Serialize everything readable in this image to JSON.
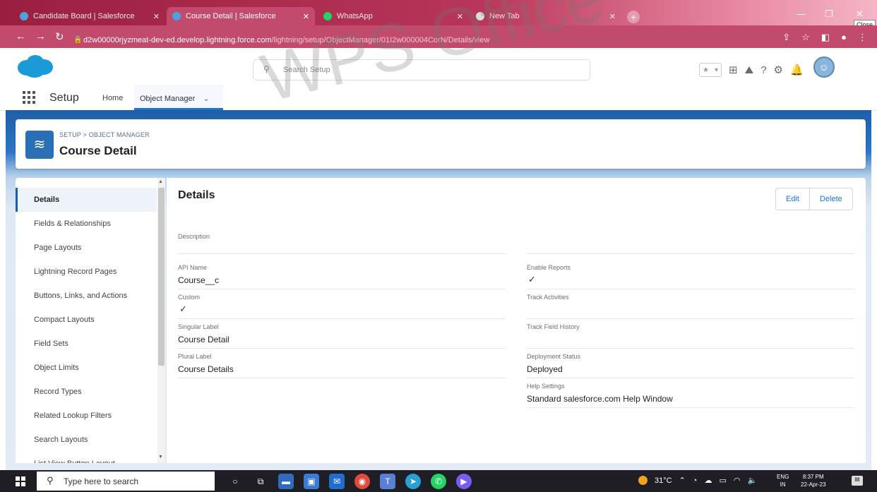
{
  "browser": {
    "tabs": [
      {
        "title": "Candidate Board | Salesforce",
        "active": false,
        "favicon_color": "#4aa3df"
      },
      {
        "title": "Course Detail | Salesforce",
        "active": true,
        "favicon_color": "#4aa3df"
      },
      {
        "title": "WhatsApp",
        "active": false,
        "favicon_color": "#25d366"
      },
      {
        "title": "New Tab",
        "active": false,
        "favicon_color": "#dddddd"
      }
    ],
    "close_tooltip": "Close",
    "url_host": "d2w00000rjyzmeat-dev-ed.develop.lightning.force.com",
    "url_path": "/lightning/setup/ObjectManager/01I2w000004CorN/Details/view"
  },
  "header": {
    "search_placeholder": "Search Setup"
  },
  "nav": {
    "app_name": "Setup",
    "home": "Home",
    "object_manager": "Object Manager"
  },
  "object": {
    "breadcrumb": "SETUP > OBJECT MANAGER",
    "title": "Course Detail"
  },
  "sidebar": {
    "items": [
      {
        "label": "Details",
        "active": true
      },
      {
        "label": "Fields & Relationships",
        "active": false
      },
      {
        "label": "Page Layouts",
        "active": false
      },
      {
        "label": "Lightning Record Pages",
        "active": false
      },
      {
        "label": "Buttons, Links, and Actions",
        "active": false
      },
      {
        "label": "Compact Layouts",
        "active": false
      },
      {
        "label": "Field Sets",
        "active": false
      },
      {
        "label": "Object Limits",
        "active": false
      },
      {
        "label": "Record Types",
        "active": false
      },
      {
        "label": "Related Lookup Filters",
        "active": false
      },
      {
        "label": "Search Layouts",
        "active": false
      },
      {
        "label": "List View Button Layout",
        "active": false
      }
    ]
  },
  "details": {
    "title": "Details",
    "edit_label": "Edit",
    "delete_label": "Delete",
    "left": [
      {
        "label": "Description",
        "value": ""
      },
      {
        "label": "API Name",
        "value": "Course__c"
      },
      {
        "label": "Custom",
        "value": "✓"
      },
      {
        "label": "Singular Label",
        "value": "Course Detail"
      },
      {
        "label": "Plural Label",
        "value": "Course Details"
      }
    ],
    "right": [
      {
        "label": "Enable Reports",
        "value": "✓"
      },
      {
        "label": "Track Activities",
        "value": ""
      },
      {
        "label": "Track Field History",
        "value": ""
      },
      {
        "label": "Deployment Status",
        "value": "Deployed"
      },
      {
        "label": "Help Settings",
        "value": "Standard salesforce.com Help Window"
      }
    ]
  },
  "watermark": "WPS Office",
  "taskbar": {
    "search_placeholder": "Type here to search",
    "weather": "31°C",
    "lang_line1": "ENG",
    "lang_line2": "IN",
    "time": "8:37 PM",
    "date": "22-Apr-23"
  }
}
